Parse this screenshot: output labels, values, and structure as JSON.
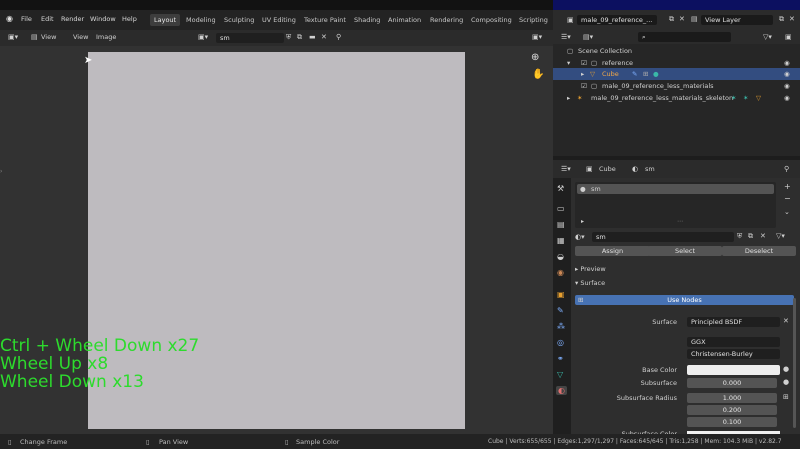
{
  "app": {
    "menus": [
      "File",
      "Edit",
      "Render",
      "Window",
      "Help"
    ],
    "workspaces": [
      "Layout",
      "Modeling",
      "Sculpting",
      "UV Editing",
      "Texture Paint",
      "Shading",
      "Animation",
      "Rendering",
      "Compositing",
      "Scripting"
    ],
    "active_workspace": "Layout",
    "add_tab": "+",
    "scene_name": "male_09_reference_...",
    "view_layer": "View Layer"
  },
  "image_editor": {
    "view_label": "View",
    "view2_label": "View",
    "image_label": "Image",
    "image_name": "sm"
  },
  "hotkeys": [
    "Ctrl + Wheel Down x27",
    "Wheel Up x8",
    "Wheel Down x13"
  ],
  "outliner": {
    "rows": [
      {
        "label": "Scene Collection"
      },
      {
        "label": "reference"
      },
      {
        "label": "Cube"
      },
      {
        "label": "male_09_reference_less_materials"
      },
      {
        "label": "male_09_reference_less_materials_skeleton"
      }
    ]
  },
  "properties": {
    "object_name": "Cube",
    "material_name": "sm",
    "slot_name": "sm",
    "material_field": "sm",
    "assign": "Assign",
    "select": "Select",
    "deselect": "Deselect",
    "preview": "Preview",
    "surface": "Surface",
    "use_nodes": "Use Nodes",
    "surface_label": "Surface",
    "surface_value": "Principled BSDF",
    "distribution": "GGX",
    "subsurface_method": "Christensen-Burley",
    "base_color_label": "Base Color",
    "base_color": "#eeeeee",
    "subsurface_label": "Subsurface",
    "subsurface_value": "0.000",
    "subsurface_radius_label": "Subsurface Radius",
    "radius": [
      "1.000",
      "0.200",
      "0.100"
    ],
    "subsurface_color_label": "Subsurface Color"
  },
  "status": {
    "change_frame": "Change Frame",
    "pan_view": "Pan View",
    "sample_color": "Sample Color",
    "stats": "Cube | Verts:655/655 | Edges:1,297/1,297 | Faces:645/645 | Tris:1,258 | Mem: 104.3 MiB | v2.82.7"
  },
  "colors": {
    "accent": "#4772b3",
    "hotkey_text": "#2ddb2d",
    "selected_row": "#334d80"
  }
}
